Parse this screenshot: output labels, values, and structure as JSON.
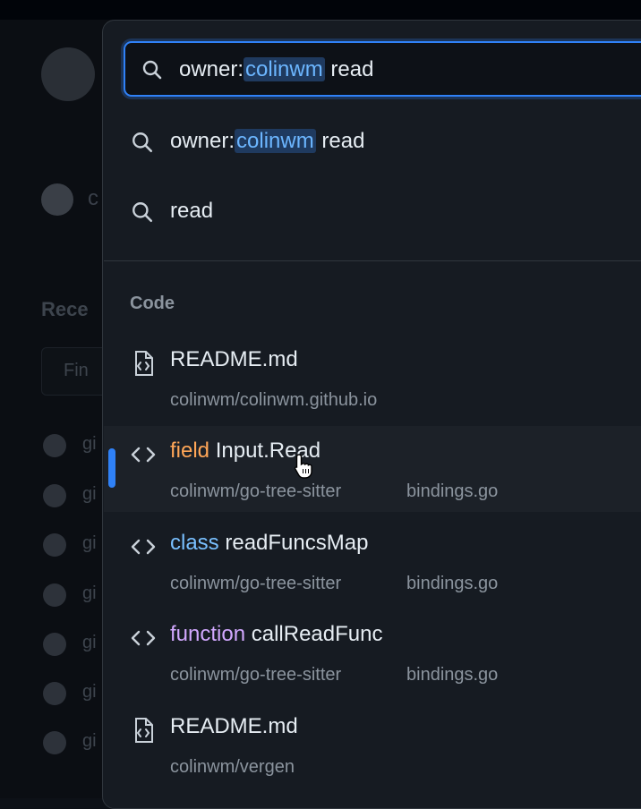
{
  "search": {
    "query_prefix": "owner:",
    "query_owner": "colinwm",
    "query_term": "read"
  },
  "suggestions": [
    {
      "prefix": "owner:",
      "owner": "colinwm",
      "term": "read"
    },
    {
      "prefix": "",
      "owner": "",
      "term": "read"
    }
  ],
  "code_section": {
    "title": "Code",
    "results": [
      {
        "kind": "",
        "name": "README.md",
        "repo": "colinwm/colinwm.github.io",
        "file": "",
        "icon": "file-code-icon"
      },
      {
        "kind": "field",
        "name": "Input.Read",
        "repo": "colinwm/go-tree-sitter",
        "file": "bindings.go",
        "icon": "code-icon"
      },
      {
        "kind": "class",
        "name": "readFuncsMap",
        "repo": "colinwm/go-tree-sitter",
        "file": "bindings.go",
        "icon": "code-icon"
      },
      {
        "kind": "function",
        "name": "callReadFunc",
        "repo": "colinwm/go-tree-sitter",
        "file": "bindings.go",
        "icon": "code-icon"
      },
      {
        "kind": "",
        "name": "README.md",
        "repo": "colinwm/vergen",
        "file": "",
        "icon": "file-code-icon"
      }
    ]
  },
  "background": {
    "user_initial": "c",
    "recent_label": "Rece",
    "find_label": "Fin",
    "repo_stub": "gi"
  },
  "colors": {
    "accent": "#2f81f7",
    "field_kind": "#ffa657",
    "class_kind": "#79c0ff",
    "function_kind": "#d2a8ff"
  }
}
